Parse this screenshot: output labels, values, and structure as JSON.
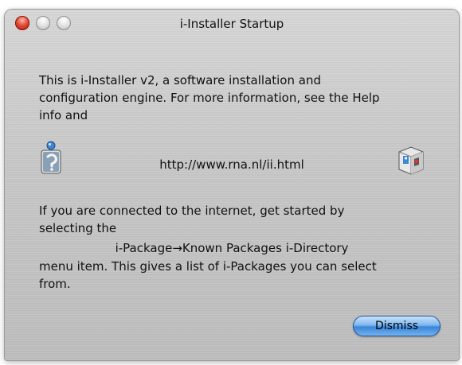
{
  "window": {
    "title": "i-Installer Startup"
  },
  "content": {
    "intro_line1": "This is i-Installer v2, a software installation and",
    "intro_line2": "configuration engine. For more information, see the Help",
    "intro_line3": "info and",
    "url": "http://www.rna.nl/ii.html",
    "connect_line1": "If you are connected to the internet, get started by",
    "connect_line2": "selecting the",
    "menu_path": "i-Package→Known Packages i-Directory",
    "menu_line1": "menu item. This gives a list of i-Packages you can select",
    "menu_line2": "from."
  },
  "buttons": {
    "dismiss": "Dismiss"
  },
  "icons": {
    "left": "i-installer-help-icon",
    "right": "i-installer-box-icon"
  },
  "colors": {
    "close": "#e04a35",
    "button": "#3a86d9"
  }
}
